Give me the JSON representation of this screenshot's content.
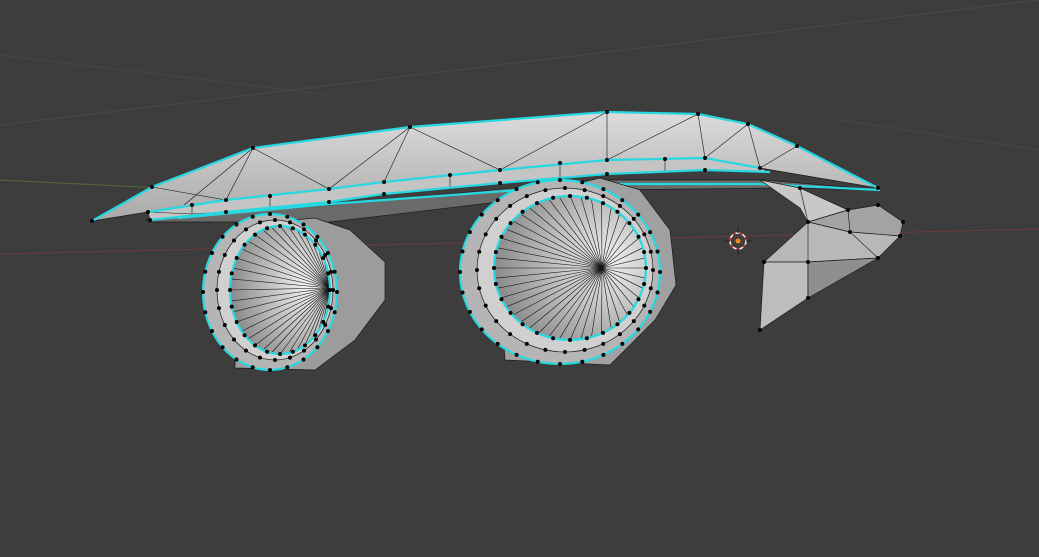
{
  "viewport": {
    "background": "#3d3d3d",
    "mode": "edit-mode",
    "object": "wing-mesh"
  },
  "colors": {
    "seam_edges": "#27d8e0",
    "vertices": "#050505",
    "faces_light": "#cfcfcf",
    "faces_dark": "#8a8a8a",
    "x_axis": "#6e3a3a",
    "y_axis": "#556b3a",
    "cursor_ring": "#e9e9e9",
    "cursor_center": "#f08a1c"
  },
  "icons": {
    "cursor": "3d-cursor-icon"
  }
}
